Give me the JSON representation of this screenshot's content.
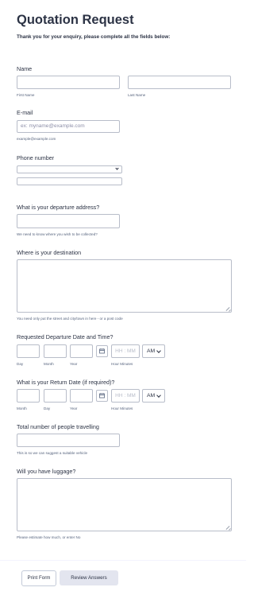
{
  "form": {
    "title": "Quotation Request",
    "subtitle": "Thank you for your enquiry, please complete all the fields below:"
  },
  "name": {
    "label": "Name",
    "first_sublabel": "First Name",
    "last_sublabel": "Last Name"
  },
  "email": {
    "label": "E-mail",
    "placeholder": "ex: myname@example.com",
    "sublabel": "example@example.com"
  },
  "phone": {
    "label": "Phone number"
  },
  "departure_address": {
    "label": "What is your departure address?",
    "sublabel": "We need to know where you wish to be collected?"
  },
  "destination": {
    "label": "Where is your destination",
    "sublabel": "You need only put the street and city/town in here - or a post code"
  },
  "departure_datetime": {
    "label": "Requested Departure Date and Time?",
    "day": "Day",
    "month": "Month",
    "year": "Year",
    "time_placeholder": "HH : MM",
    "ampm": "AM",
    "hour_minutes": "Hour Minutes"
  },
  "return_date": {
    "label": "What is your Return Date (if required)?",
    "month": "Month",
    "day": "Day",
    "year": "Year",
    "time_placeholder": "HH : MM",
    "ampm": "AM",
    "hour_minutes": "Hour Minutes"
  },
  "people": {
    "label": "Total number of people travelling",
    "sublabel": "This is so we can suggest a suitable vehicle"
  },
  "luggage": {
    "label": "Will you have luggage?",
    "sublabel": "Please estimate how much, or enter No"
  },
  "buttons": {
    "print": "Print Form",
    "review": "Review Answers"
  },
  "colors": {
    "text": "#2c3345",
    "border": "#b8bdc9",
    "sublabel": "#57647e",
    "review_bg": "#e3e5ef"
  }
}
